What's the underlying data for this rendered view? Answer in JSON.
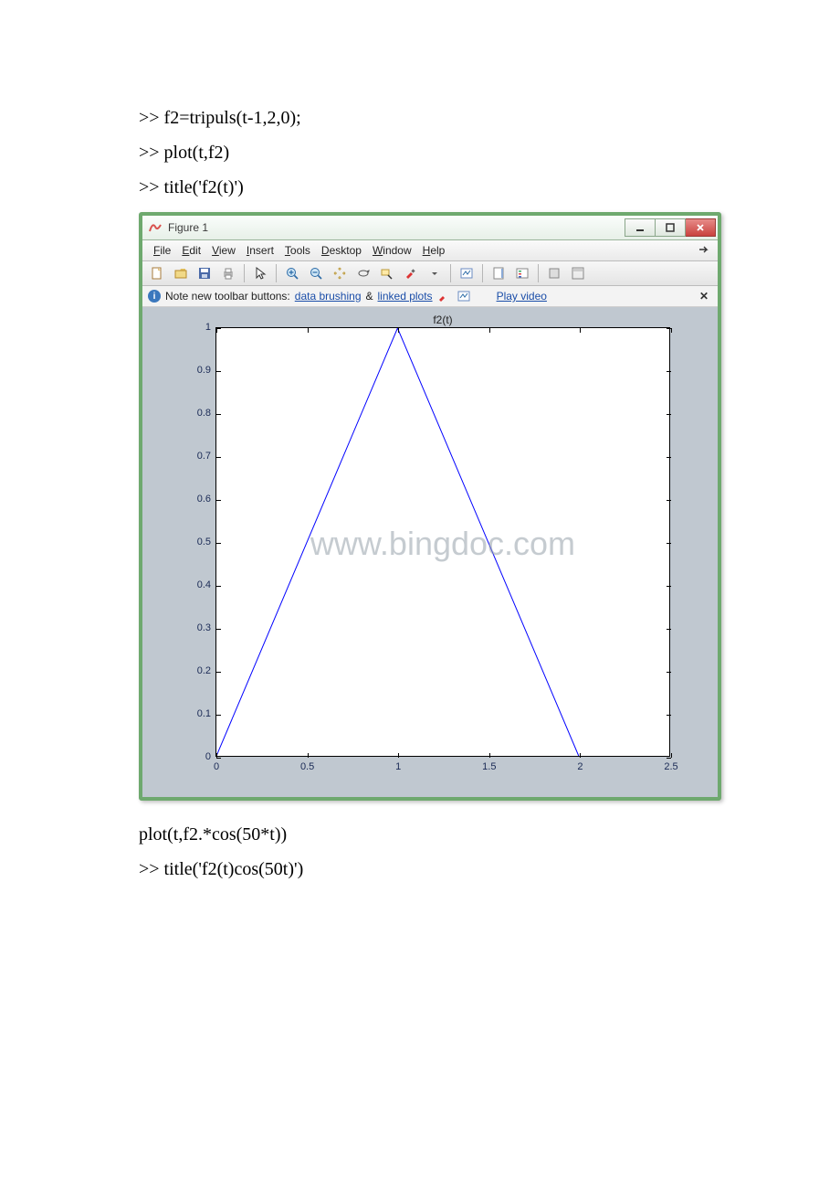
{
  "code_before": [
    ">> f2=tripuls(t-1,2,0);",
    ">> plot(t,f2)",
    ">> title('f2(t)')"
  ],
  "code_after": [
    "plot(t,f2.*cos(50*t))",
    ">> title('f2(t)cos(50t)')"
  ],
  "window": {
    "title": "Figure 1",
    "menus": [
      "File",
      "Edit",
      "View",
      "Insert",
      "Tools",
      "Desktop",
      "Window",
      "Help"
    ],
    "note_prefix": "Note new toolbar buttons:",
    "note_link1": "data brushing",
    "note_amp": "&",
    "note_link2": "linked plots",
    "note_play": "Play video"
  },
  "watermark": "www.bingdoc.com",
  "chart_data": {
    "type": "line",
    "title": "f2(t)",
    "xlabel": "",
    "ylabel": "",
    "xlim": [
      0,
      2.5
    ],
    "ylim": [
      0,
      1
    ],
    "xticks": [
      0,
      0.5,
      1,
      1.5,
      2,
      2.5
    ],
    "yticks": [
      0,
      0.1,
      0.2,
      0.3,
      0.4,
      0.5,
      0.6,
      0.7,
      0.8,
      0.9,
      1
    ],
    "series": [
      {
        "name": "f2(t)",
        "x": [
          0,
          1,
          2
        ],
        "y": [
          0,
          1,
          0
        ],
        "color": "#0000ff"
      }
    ]
  }
}
